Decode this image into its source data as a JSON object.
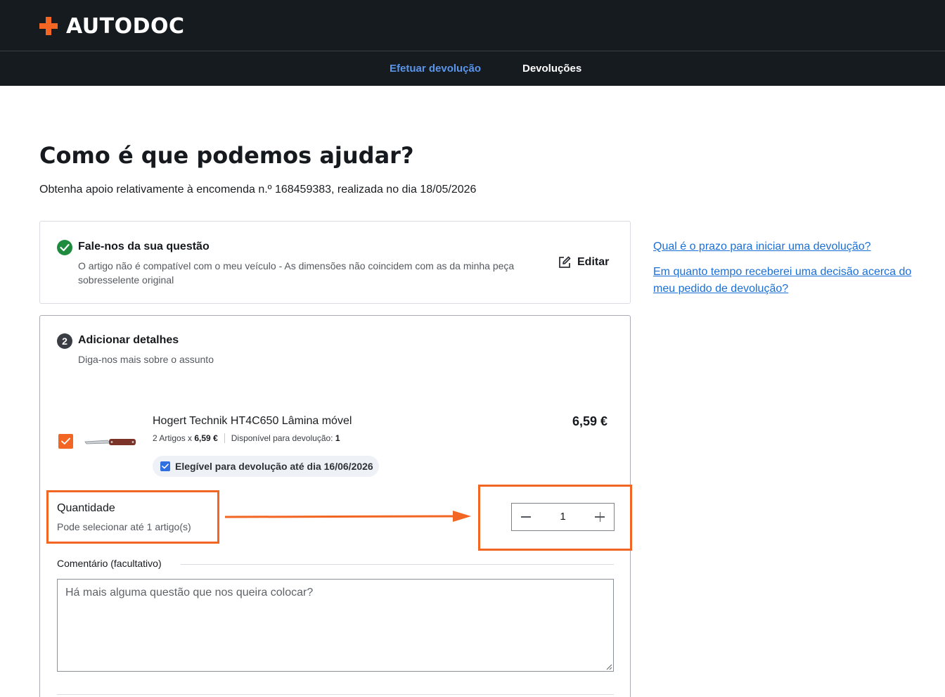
{
  "brand": {
    "name": "AUTODOC",
    "accent": "#f26522"
  },
  "nav": {
    "items": [
      {
        "label": "Efetuar devolução",
        "active": true
      },
      {
        "label": "Devoluções",
        "active": false
      }
    ]
  },
  "main": {
    "title": "Como é que podemos ajudar?",
    "subtitle": "Obtenha apoio relativamente à encomenda n.º 168459383, realizada no dia 18/05/2026"
  },
  "step1": {
    "title": "Fale-nos da sua questão",
    "text": "O artigo não é compatível com o meu veículo - As dimensões não coincidem com as da minha peça sobresselente original",
    "edit_label": "Editar",
    "status_icon": "check-circle-icon"
  },
  "step2": {
    "number": "2",
    "title": "Adicionar detalhes",
    "subtitle": "Diga-nos mais sobre o assunto",
    "item": {
      "checked": true,
      "name": "Hogert Technik HT4C650 Lâmina móvel",
      "quantity_text": "2 Artigos x",
      "unit_price": "6,59 €",
      "available_label": "Disponível para devolução:",
      "available_value": "1",
      "price": "6,59 €",
      "eligible_text": "Elegível para devolução até dia 16/06/2026"
    },
    "quantity": {
      "label": "Quantidade",
      "hint": "Pode selecionar até 1 artigo(s)",
      "value": "1"
    },
    "comment": {
      "label": "Comentário (facultativo)",
      "placeholder": "Há mais alguma questão que nos queira colocar?",
      "value": ""
    }
  },
  "side_links": [
    "Qual é o prazo para iniciar uma devolução?",
    "Em quanto tempo receberei uma decisão acerca do meu pedido de devolução?"
  ],
  "annotation": {
    "color": "#f26522"
  }
}
